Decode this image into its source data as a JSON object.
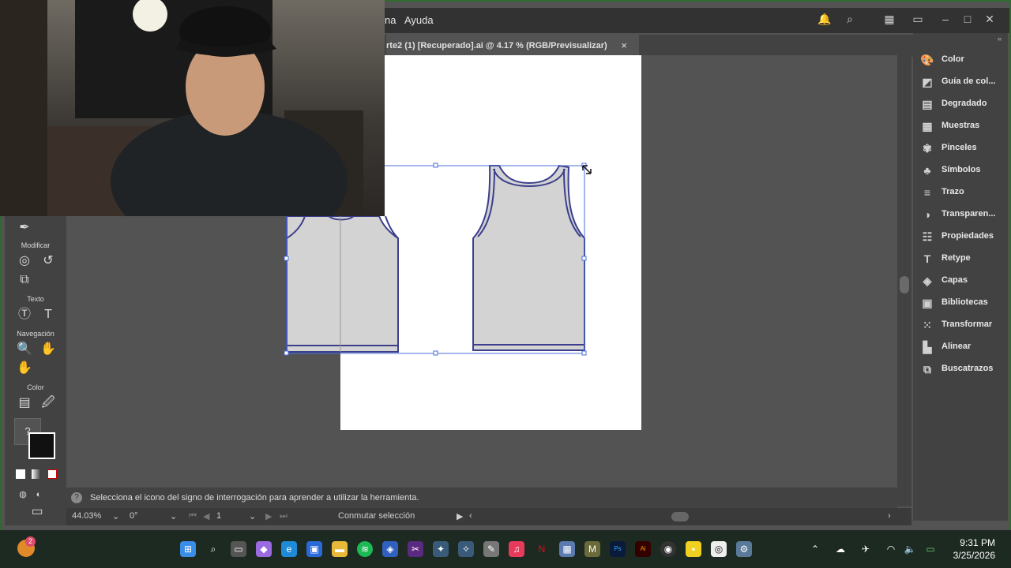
{
  "menubar": {
    "partial_menu": "na",
    "help": "Ayuda"
  },
  "document_tab": {
    "title": "rte2  (1) [Recuperado].ai @ 4.17 % (RGB/Previsualizar)",
    "close": "×"
  },
  "toolbar": {
    "section_modify": "Modificar",
    "section_text": "Texto",
    "section_nav": "Navegación",
    "section_color": "Color",
    "help_glyph": "?"
  },
  "panels": [
    {
      "label": "Color",
      "icon": "palette-icon"
    },
    {
      "label": "Guía de col...",
      "icon": "color-guide-icon"
    },
    {
      "label": "Degradado",
      "icon": "gradient-icon"
    },
    {
      "label": "Muestras",
      "icon": "swatches-icon"
    },
    {
      "label": "Pinceles",
      "icon": "brush-icon"
    },
    {
      "label": "Símbolos",
      "icon": "symbols-icon"
    },
    {
      "label": "Trazo",
      "icon": "stroke-icon"
    },
    {
      "label": "Transparen...",
      "icon": "transparency-icon"
    },
    {
      "label": "Propiedades",
      "icon": "properties-icon"
    },
    {
      "label": "Retype",
      "icon": "retype-icon"
    },
    {
      "label": "Capas",
      "icon": "layers-icon"
    },
    {
      "label": "Bibliotecas",
      "icon": "libraries-icon"
    },
    {
      "label": "Transformar",
      "icon": "transform-icon"
    },
    {
      "label": "Alinear",
      "icon": "align-icon"
    },
    {
      "label": "Buscatrazos",
      "icon": "pathfinder-icon"
    }
  ],
  "hint": {
    "text": "Selecciona el icono del signo de interrogación para aprender a utilizar la herramienta."
  },
  "status": {
    "zoom": "44.03%",
    "rotation": "0°",
    "artboard": "1",
    "toggle": "Conmutar selección"
  },
  "taskbar": {
    "notification_count": "2",
    "time": "9:31 PM",
    "date": "3/25/2026"
  },
  "colors": {
    "garment_fill": "#d3d3d3",
    "garment_stroke": "#3c3f8c",
    "selection": "#4a6cd8"
  }
}
